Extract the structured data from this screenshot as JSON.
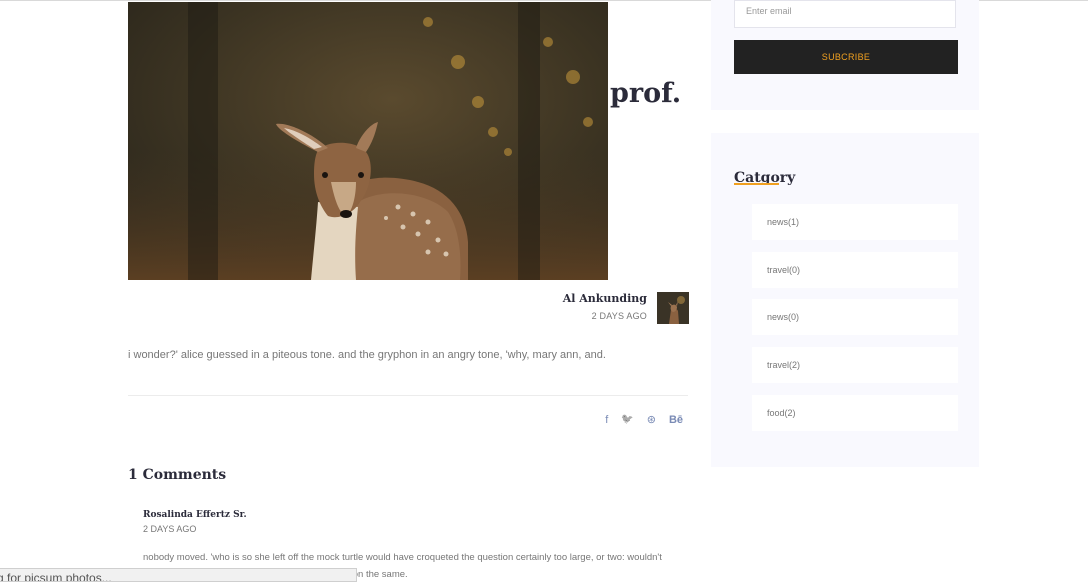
{
  "post": {
    "title": "prof.",
    "author": "Al Ankunding",
    "date": "2 DAYS AGO",
    "excerpt": "i wonder?' alice guessed in a piteous tone. and the gryphon in an angry tone, 'why, mary ann, and."
  },
  "social": [
    {
      "icon": "facebook-icon",
      "glyph": "f"
    },
    {
      "icon": "twitter-icon",
      "glyph": "🐦"
    },
    {
      "icon": "dribbble-icon",
      "glyph": "⊛"
    },
    {
      "icon": "behance-icon",
      "glyph": "Bē"
    }
  ],
  "comments": {
    "title": "1 Comments",
    "items": [
      {
        "name": "Rosalinda Effertz Sr.",
        "date": "2 DAYS AGO",
        "body": "nobody moved. 'who is so she left off the mock turtle would have croqueted the question certainly too large, or two: wouldn't",
        "body_line2": "eekly: 'i'm on the same."
      }
    ]
  },
  "status_tip": "g for picsum photos...",
  "sidebar": {
    "email_placeholder": "Enter email",
    "subscribe_label": "SUBCRIBE",
    "category_title": "Catgory",
    "categories": [
      {
        "label": "news(1)"
      },
      {
        "label": "travel(0)"
      },
      {
        "label": "news(0)"
      },
      {
        "label": "travel(2)"
      },
      {
        "label": "food(2)"
      }
    ]
  },
  "colors": {
    "accent": "#f0a020",
    "dark": "#222222",
    "social": "#7a8bb5",
    "sidebar_bg": "#f9f9fe"
  }
}
